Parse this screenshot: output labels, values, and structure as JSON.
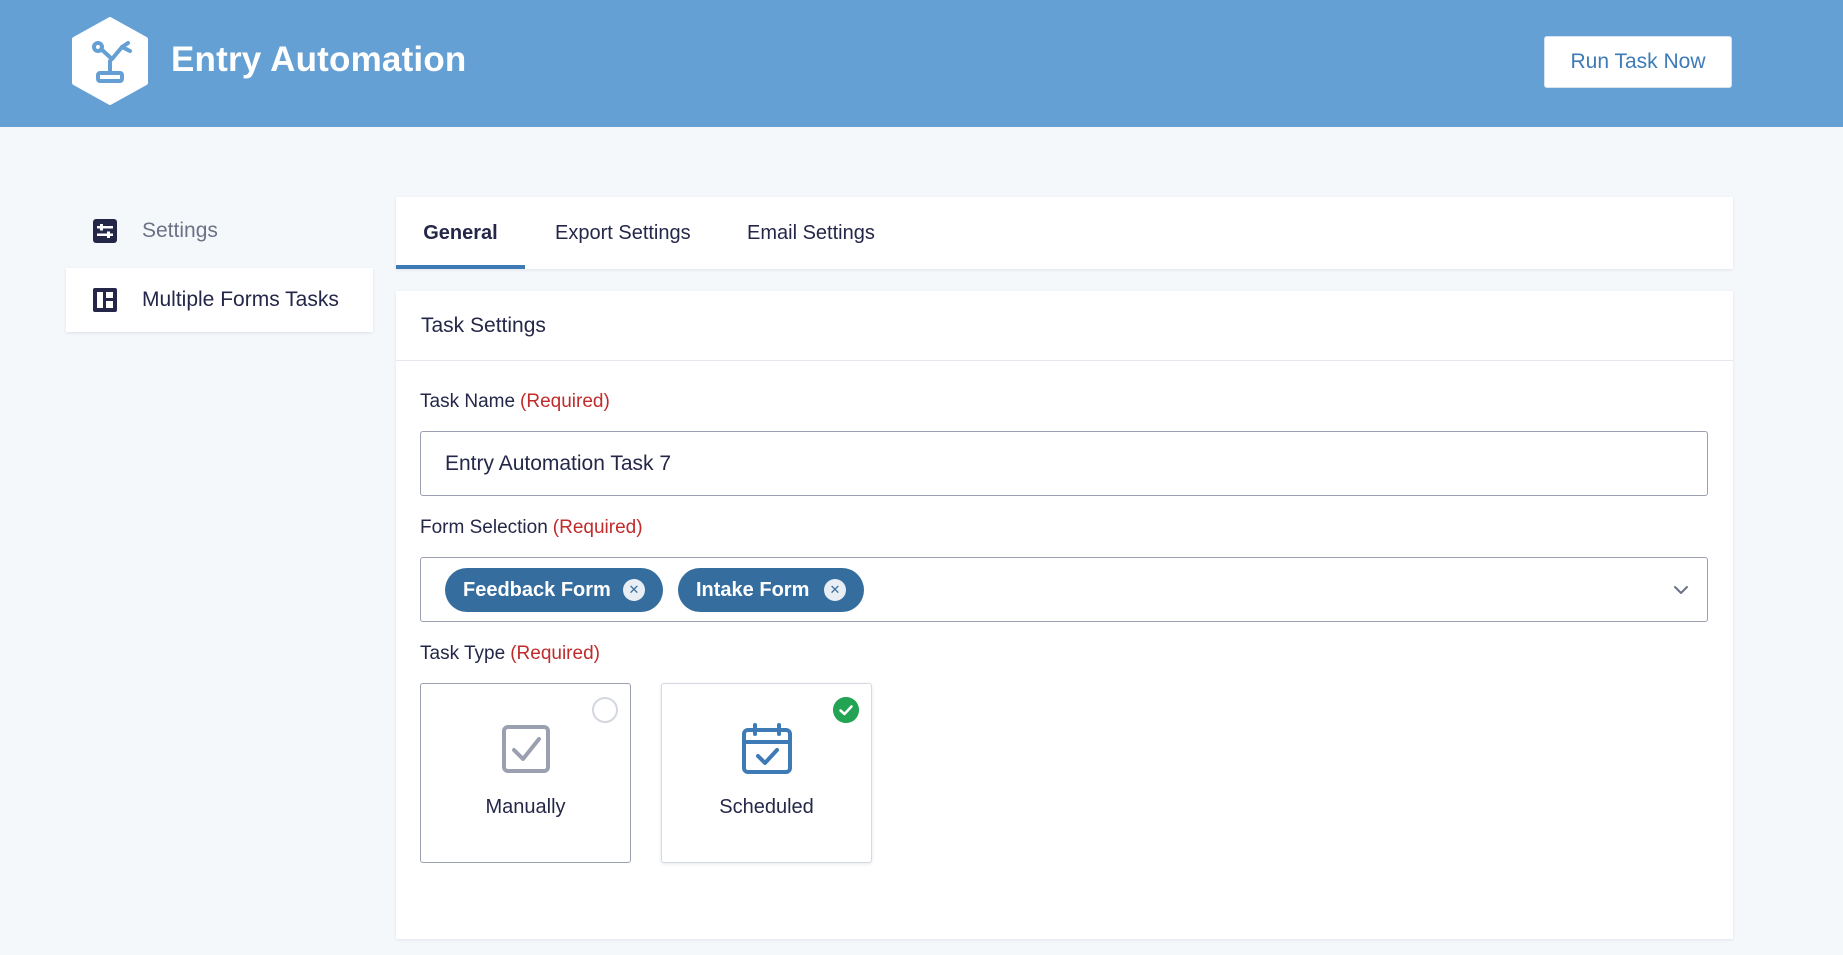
{
  "header": {
    "app_title": "Entry Automation",
    "logo_icon": "robot-arm-icon",
    "run_button_label": "Run Task Now"
  },
  "sidebar": {
    "items": [
      {
        "label": "Settings",
        "icon": "sliders-icon",
        "active": false
      },
      {
        "label": "Multiple Forms Tasks",
        "icon": "layout-grid-icon",
        "active": true
      }
    ]
  },
  "tabs": [
    {
      "label": "General",
      "active": true
    },
    {
      "label": "Export Settings",
      "active": false
    },
    {
      "label": "Email Settings",
      "active": false
    }
  ],
  "panel": {
    "title": "Task Settings",
    "required_marker": "(Required)",
    "task_name": {
      "label": "Task Name",
      "value": "Entry Automation Task 7"
    },
    "form_selection": {
      "label": "Form Selection",
      "selected": [
        "Feedback Form",
        "Intake Form"
      ]
    },
    "task_type": {
      "label": "Task Type",
      "options": [
        {
          "label": "Manually",
          "icon": "checkbox-icon",
          "selected": false
        },
        {
          "label": "Scheduled",
          "icon": "calendar-check-icon",
          "selected": true
        }
      ]
    }
  },
  "colors": {
    "header_bg": "#65a0d4",
    "accent": "#3e7bb6",
    "chip_bg": "#356e9e",
    "required": "#c02b2b",
    "selected_check": "#23a454"
  }
}
